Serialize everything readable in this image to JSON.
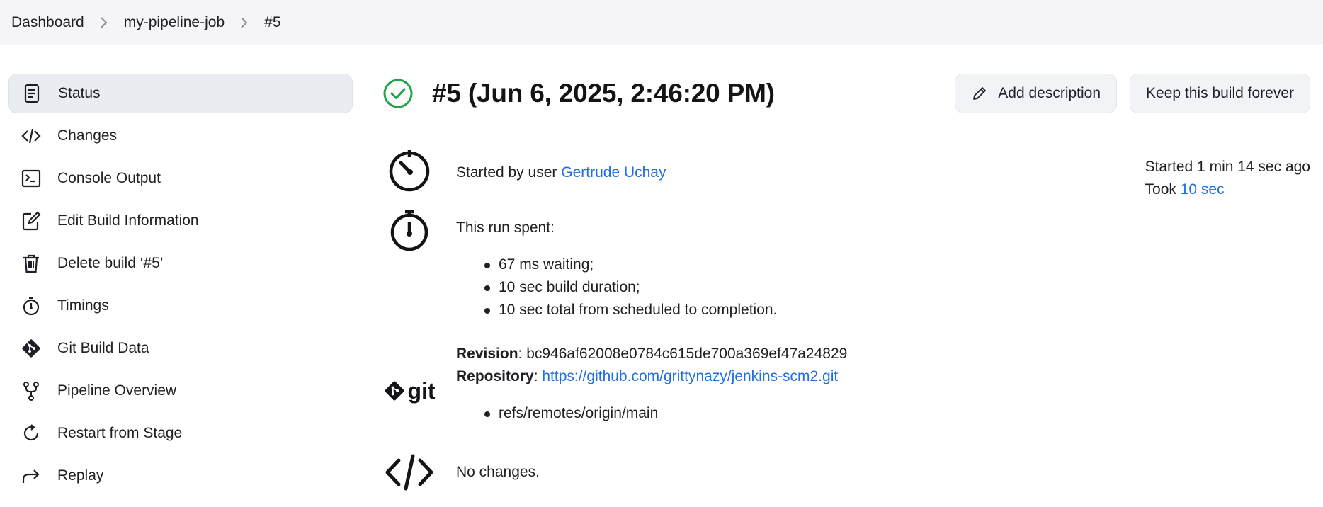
{
  "breadcrumb": {
    "items": [
      "Dashboard",
      "my-pipeline-job",
      "#5"
    ]
  },
  "sidebar": {
    "items": [
      {
        "label": "Status",
        "icon": "status-document-icon"
      },
      {
        "label": "Changes",
        "icon": "code-icon"
      },
      {
        "label": "Console Output",
        "icon": "terminal-icon"
      },
      {
        "label": "Edit Build Information",
        "icon": "edit-icon"
      },
      {
        "label": "Delete build ‘#5’",
        "icon": "trash-icon"
      },
      {
        "label": "Timings",
        "icon": "stopwatch-icon"
      },
      {
        "label": "Git Build Data",
        "icon": "git-diamond-icon"
      },
      {
        "label": "Pipeline Overview",
        "icon": "branch-icon"
      },
      {
        "label": "Restart from Stage",
        "icon": "restart-icon"
      },
      {
        "label": "Replay",
        "icon": "replay-icon"
      }
    ]
  },
  "build": {
    "title": "#5 (Jun 6, 2025, 2:46:20 PM)",
    "status_color": "#1ea446",
    "add_description": "Add description",
    "keep_forever": "Keep this build forever",
    "started_by_prefix": "Started by user ",
    "started_by_user": "Gertrude Uchay",
    "started_ago": "Started 1 min 14 sec ago",
    "took_prefix": "Took ",
    "took_value": "10 sec",
    "run_spent_label": "This run spent:",
    "run_spent_items": [
      "67 ms waiting;",
      "10 sec build duration;",
      "10 sec total from scheduled to completion."
    ],
    "git": {
      "logo_text": "git",
      "revision_label": "Revision",
      "revision_value": "bc946af62008e0784c615de700a369ef47a24829",
      "repository_label": "Repository",
      "repository_url": "https://github.com/grittynazy/jenkins-scm2.git",
      "refs": [
        "refs/remotes/origin/main"
      ]
    },
    "changes_text": "No changes."
  },
  "colors": {
    "link": "#1f6fe0",
    "active_bg": "#e9edf2",
    "breadcrumb_bg": "#f5f5f7"
  }
}
